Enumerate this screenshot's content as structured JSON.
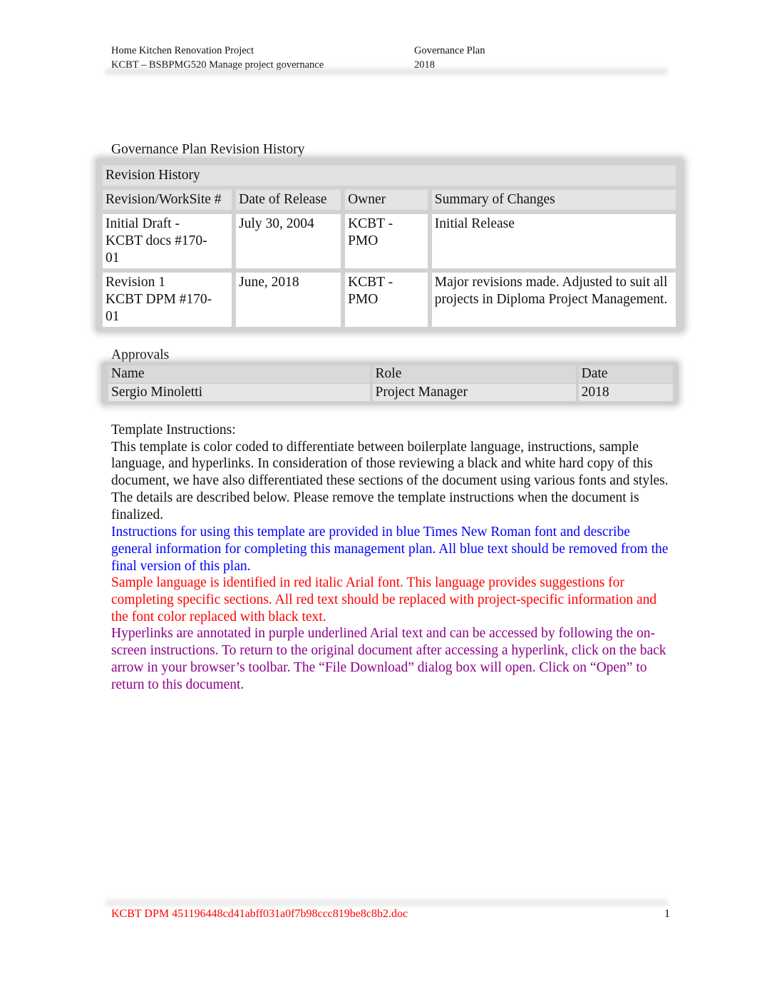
{
  "header": {
    "project": "Home Kitchen Renovation Project",
    "course": "KCBT – BSBPMG520 Manage project governance",
    "doc_type": "Governance Plan",
    "year": "2018"
  },
  "revision_history": {
    "section_title": "Governance Plan Revision History",
    "table_title": "Revision History",
    "columns": [
      "Revision/WorkSite #",
      "Date of Release",
      "Owner",
      "Summary of Changes"
    ],
    "rows": [
      [
        "Initial Draft - KCBT docs #170-01",
        "July 30, 2004",
        "KCBT - PMO",
        "Initial Release"
      ],
      [
        "Revision 1 KCBT DPM #170-01",
        "June, 2018",
        "KCBT - PMO",
        "Major revisions made. Adjusted to suit all projects in Diploma Project Management."
      ]
    ],
    "row_lines": [
      [
        "Initial Draft -",
        "KCBT docs #170-",
        "01"
      ],
      [
        "Revision 1",
        "KCBT DPM #170-",
        "01"
      ]
    ]
  },
  "approvals": {
    "section_title": "Approvals",
    "columns": [
      "Name",
      "Role",
      "Date"
    ],
    "rows": [
      [
        "Sergio Minoletti",
        "Project Manager",
        "2018"
      ]
    ]
  },
  "instructions": {
    "title": "Template Instructions:",
    "intro": "This template is color coded to differentiate between boilerplate language, instructions, sample language, and hyperlinks. In consideration of those reviewing a black and white hard copy of this document, we have also differentiated these sections of the document using various fonts and styles. The details are described below. Please remove the template instructions when the document is finalized.",
    "blue_text": "Instructions for using this template are provided in blue Times New Roman font and describe general information for completing this management plan. All blue text should be removed from the final version of this plan.",
    "red_text": "Sample language is identified in red italic Arial font. This language provides suggestions for completing specific sections. All red text should be replaced with project-specific information and the font color replaced with black text.",
    "purple_text": "Hyperlinks are annotated in purple underlined Arial text and can be accessed by following the on-screen instructions. To return to the original document after accessing a hyperlink, click on the back arrow in your browser’s toolbar. The “File Download” dialog box will open. Click on “Open” to return to this document.",
    "colors": {
      "blue": "#0000ff",
      "red": "#ff0000",
      "purple": "#8b008b"
    }
  },
  "footer": {
    "doc_name": "KCBT DPM 451196448cd41abff031a0f7b98ccc819be8c8b2.doc",
    "page_number": "1"
  }
}
